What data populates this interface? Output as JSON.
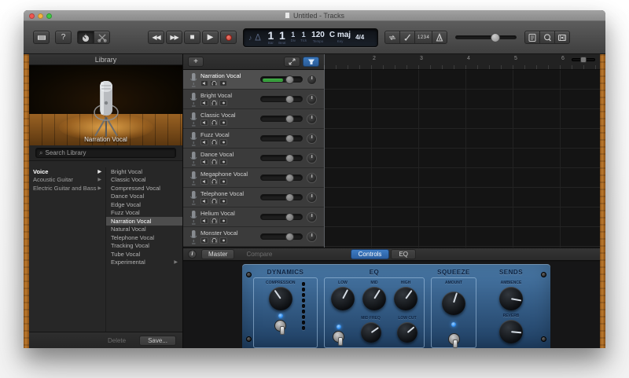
{
  "window": {
    "title": "Untitled - Tracks"
  },
  "toolbar": {
    "help_label": "?",
    "count_in_label": "1234",
    "transport": {
      "rewind": "◀◀",
      "forward": "▶▶",
      "stop": "■",
      "play": "▶"
    },
    "lcd": {
      "note_icon": "♪",
      "bar": "1",
      "beat": "1",
      "div": "1",
      "tick": "1",
      "tempo": "120",
      "key": "C maj",
      "time_sig": "4/4",
      "labels": {
        "bar": "Bar",
        "beat": "Beat",
        "div": "Div",
        "tick": "Tick",
        "tempo": "Tempo",
        "key": "Key"
      }
    }
  },
  "library": {
    "header": "Library",
    "caption": "Narration Vocal",
    "search_placeholder": "Search Library",
    "search_icon": "⌕",
    "categories": [
      {
        "label": "Voice",
        "selected": true
      },
      {
        "label": "Acoustic Guitar"
      },
      {
        "label": "Electric Guitar and Bass"
      }
    ],
    "patches": [
      {
        "label": "Bright Vocal"
      },
      {
        "label": "Classic Vocal"
      },
      {
        "label": "Compressed Vocal"
      },
      {
        "label": "Dance Vocal"
      },
      {
        "label": "Edge Vocal"
      },
      {
        "label": "Fuzz Vocal"
      },
      {
        "label": "Narration Vocal",
        "selected": true
      },
      {
        "label": "Natural Vocal"
      },
      {
        "label": "Telephone Vocal"
      },
      {
        "label": "Tracking Vocal"
      },
      {
        "label": "Tube Vocal"
      },
      {
        "label": "Experimental",
        "arrow": true
      }
    ],
    "footer": {
      "delete_label": "Delete",
      "save_label": "Save..."
    }
  },
  "tracks": {
    "add_label": "+",
    "ruler_numbers": [
      "2",
      "3",
      "4",
      "5",
      "6"
    ],
    "rows": [
      {
        "name": "Narration Vocal",
        "selected": true,
        "meter": true
      },
      {
        "name": "Bright Vocal"
      },
      {
        "name": "Classic Vocal"
      },
      {
        "name": "Fuzz Vocal"
      },
      {
        "name": "Dance Vocal"
      },
      {
        "name": "Megaphone Vocal"
      },
      {
        "name": "Telephone Vocal"
      },
      {
        "name": "Helium Vocal"
      },
      {
        "name": "Monster Vocal"
      }
    ]
  },
  "smart_controls": {
    "info_label": "i",
    "tab_master": "Master",
    "tab_compare": "Compare",
    "btn_controls": "Controls",
    "btn_eq": "EQ",
    "sections": [
      {
        "title": "DYNAMICS",
        "knobs": [
          {
            "label": "COMPRESSION",
            "angle": -35
          }
        ]
      },
      {
        "title": "EQ",
        "knobs": [
          {
            "label": "LOW",
            "angle": 28
          },
          {
            "label": "MID",
            "angle": 32
          },
          {
            "label": "HIGH",
            "angle": 36
          },
          {
            "label": "MID FREQ",
            "angle": 55
          },
          {
            "label": "LOW CUT",
            "angle": 50
          }
        ]
      },
      {
        "title": "SQUEEZE",
        "knobs": [
          {
            "label": "AMOUNT",
            "angle": 18
          }
        ]
      },
      {
        "title": "SENDS",
        "knobs": [
          {
            "label": "AMBIENCE",
            "angle": 100
          },
          {
            "label": "REVERB",
            "angle": 95
          }
        ]
      }
    ]
  },
  "colors": {
    "accent_blue": "#3272c4",
    "amp_blue": "#33567e",
    "record_red": "#c84b42",
    "meter_green": "#49c24f",
    "wood": "#a86526"
  }
}
